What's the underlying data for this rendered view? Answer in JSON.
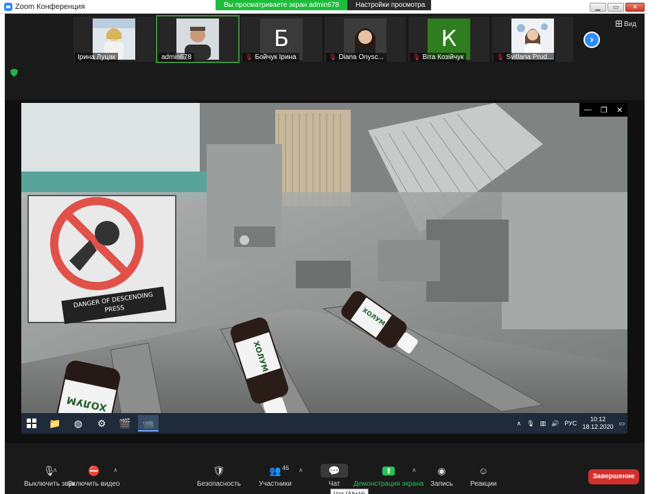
{
  "window": {
    "title": "Zoom Конференция",
    "viewing_banner": "Вы просматриваете экран admin678",
    "view_options": "Настройки просмотра"
  },
  "gallery": {
    "view_label": "Вид",
    "participants": [
      {
        "name": "Ірина Луцак",
        "muted": false,
        "avatar": "photo"
      },
      {
        "name": "admin678",
        "muted": false,
        "avatar": "photo"
      },
      {
        "name": "Бойчук Ірина",
        "muted": true,
        "avatar": "letter",
        "letter": "Б",
        "color": "#3a3a3a"
      },
      {
        "name": "Diana Onysc...",
        "muted": true,
        "avatar": "photo"
      },
      {
        "name": "Віта Козійчук",
        "muted": true,
        "avatar": "letter",
        "letter": "К",
        "color": "#2f7d1e"
      },
      {
        "name": "Svitlana Prud...",
        "muted": true,
        "avatar": "photo"
      }
    ]
  },
  "shared_screen": {
    "sign_text": "DANGER OF DESCENDING PRESS",
    "bottle_label": "ХОЛУМ",
    "taskbar": {
      "lang": "РУС",
      "time": "10:12",
      "date": "18.12.2020"
    }
  },
  "toolbar": {
    "mute": "Выключить звук",
    "video": "Включить видео",
    "security": "Безопасность",
    "participants": "Участники",
    "participants_count": "46",
    "chat": "Чат",
    "share": "Демонстрация экрана",
    "record": "Запись",
    "reactions": "Реакции",
    "end": "Завершение",
    "chat_tooltip": "Чат (Alt+H)"
  },
  "colors": {
    "accent_blue": "#2d8cff",
    "banner_green": "#1fbd3b",
    "end_red": "#d3302c"
  }
}
